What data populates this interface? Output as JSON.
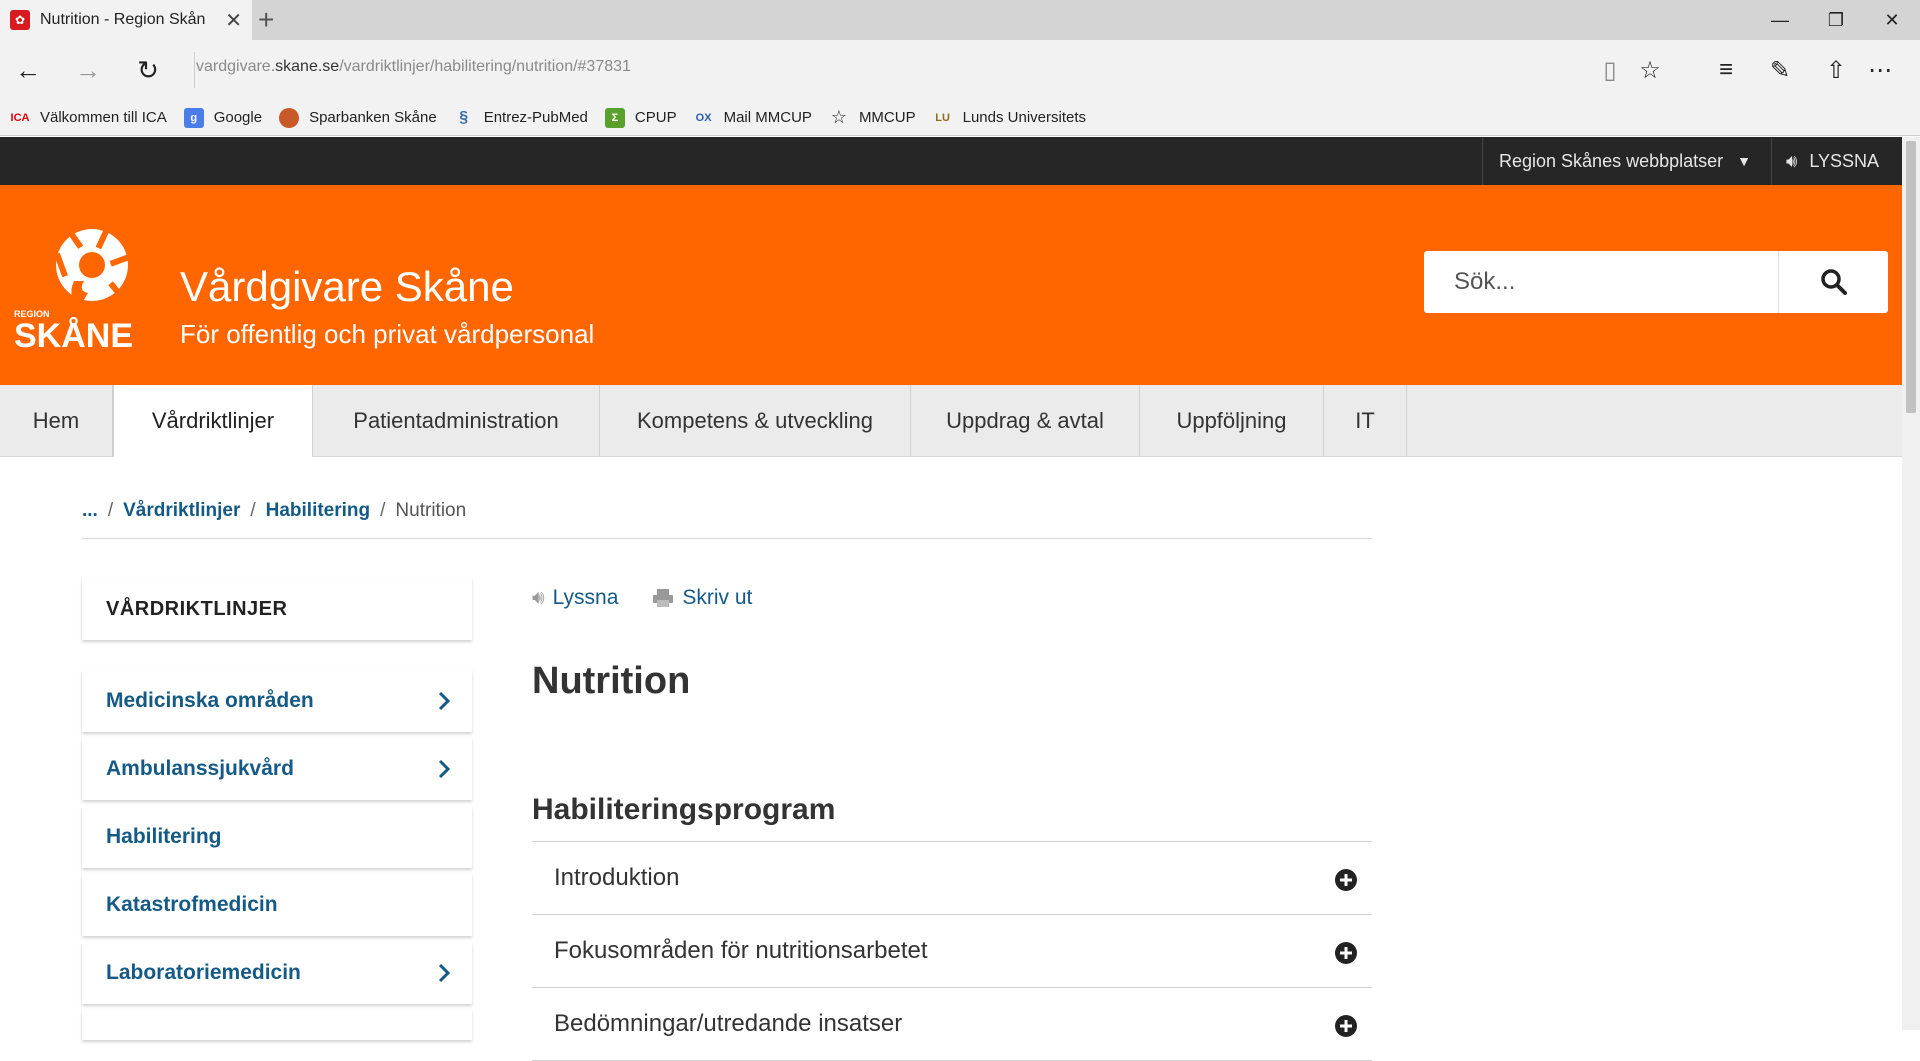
{
  "browser": {
    "tab_title": "Nutrition - Region Skån",
    "url_prefix": "vardgivare.",
    "url_domain": "skane.se",
    "url_path": "/vardriktlinjer/habilitering/nutrition/#37831",
    "favorites": [
      {
        "label": "Välkommen till ICA",
        "icon": "ica-icon",
        "color": "#e3000b"
      },
      {
        "label": "Google",
        "icon": "google-icon",
        "color": "#4a7de8"
      },
      {
        "label": "Sparbanken Skåne",
        "icon": "sparbanken-icon",
        "color": "#c85a2a"
      },
      {
        "label": "Entrez-PubMed",
        "icon": "pubmed-icon",
        "color": "#3b6ea8"
      },
      {
        "label": "CPUP",
        "icon": "cpup-icon",
        "color": "#5aa02c"
      },
      {
        "label": "Mail MMCUP",
        "icon": "mail-icon",
        "color": "#2a5db0"
      },
      {
        "label": "MMCUP",
        "icon": "star-icon",
        "color": "#333333"
      },
      {
        "label": "Lunds Universitets",
        "icon": "lu-icon",
        "color": "#8a6d1c"
      }
    ]
  },
  "topbar": {
    "sites_dropdown": "Region Skånes webbplatser",
    "listen": "LYSSNA"
  },
  "header": {
    "logo_small": "REGION",
    "logo_big": "SKÅNE",
    "title": "Vårdgivare Skåne",
    "subtitle": "För offentlig och privat vårdpersonal",
    "search_placeholder": "Sök...",
    "brand_color": "#ff6600"
  },
  "nav": {
    "items": [
      {
        "label": "Hem"
      },
      {
        "label": "Vårdriktlinjer"
      },
      {
        "label": "Patientadministration"
      },
      {
        "label": "Kompetens & utveckling"
      },
      {
        "label": "Uppdrag & avtal"
      },
      {
        "label": "Uppföljning"
      },
      {
        "label": "IT"
      }
    ],
    "active_index": 1
  },
  "breadcrumb": {
    "root": "...",
    "level1": "Vårdriktlinjer",
    "level2": "Habilitering",
    "current": "Nutrition",
    "separator": "/"
  },
  "sidebar": {
    "heading": "VÅRDRIKTLINJER",
    "items": [
      {
        "label": "Medicinska områden",
        "has_children": true
      },
      {
        "label": "Ambulanssjukvård",
        "has_children": true
      },
      {
        "label": "Habilitering",
        "has_children": false
      },
      {
        "label": "Katastrofmedicin",
        "has_children": false
      },
      {
        "label": "Laboratoriemedicin",
        "has_children": true
      }
    ]
  },
  "content": {
    "listen_label": "Lyssna",
    "print_label": "Skriv ut",
    "title": "Nutrition",
    "section_title": "Habiliteringsprogram",
    "accordion": [
      {
        "label": "Introduktion"
      },
      {
        "label": "Fokusområden för nutritionsarbetet"
      },
      {
        "label": "Bedömningar/utredande insatser"
      }
    ],
    "link_color": "#155a87"
  }
}
